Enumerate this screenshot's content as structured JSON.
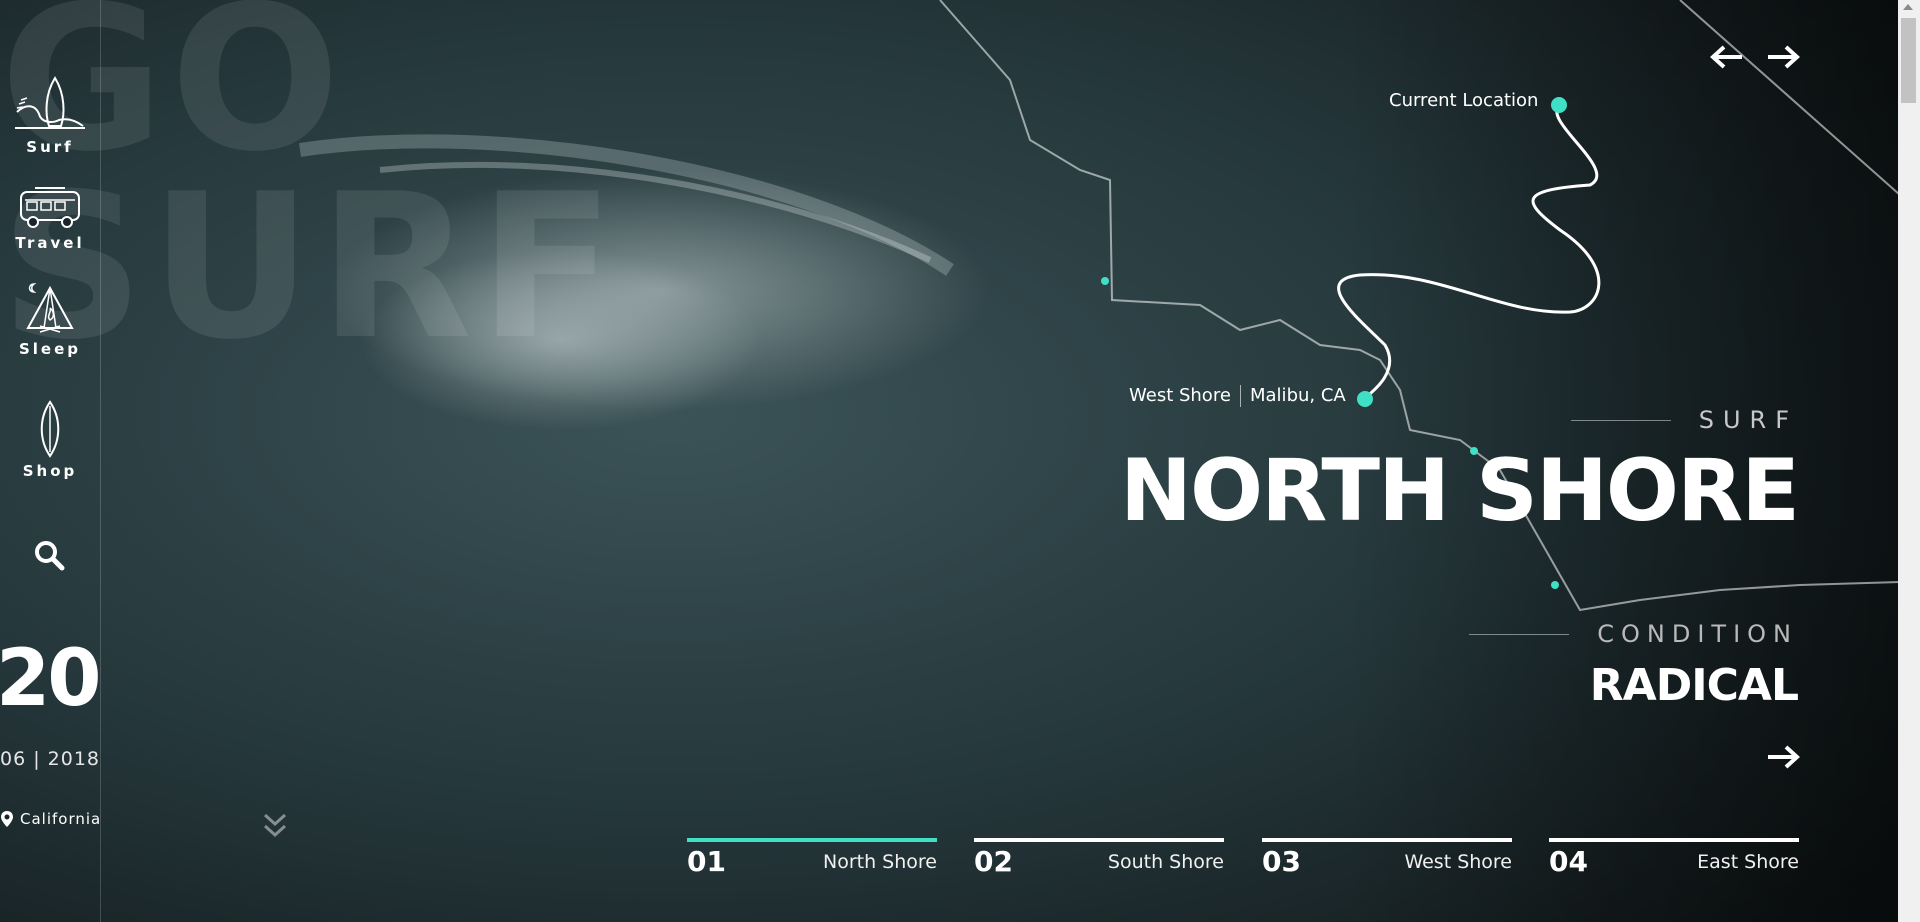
{
  "ghost_text": {
    "line1": "GO",
    "line2": "SURF"
  },
  "sidebar": {
    "items": [
      {
        "label": "Surf",
        "icon": "surfboard-wave-icon"
      },
      {
        "label": "Travel",
        "icon": "van-icon"
      },
      {
        "label": "Sleep",
        "icon": "tent-icon"
      },
      {
        "label": "Shop",
        "icon": "surfboard-icon"
      }
    ],
    "search_icon": "search-icon"
  },
  "date": {
    "day": "20",
    "month_year": "06 | 2018"
  },
  "location": {
    "label": "California",
    "icon": "map-pin-icon"
  },
  "map": {
    "current_location": "Current Location",
    "spot": "West Shore",
    "city": "Malibu, CA"
  },
  "hero": {
    "kicker": "SURF",
    "title": "NORTH SHORE",
    "condition_kicker": "CONDITION",
    "condition_value": "RADICAL"
  },
  "tabs": [
    {
      "num": "01",
      "name": "North Shore",
      "active": true
    },
    {
      "num": "02",
      "name": "South Shore",
      "active": false
    },
    {
      "num": "03",
      "name": "West Shore",
      "active": false
    },
    {
      "num": "04",
      "name": "East Shore",
      "active": false
    }
  ],
  "colors": {
    "accent": "#3fe0c5",
    "background": "#1b2428",
    "text": "#ffffff"
  }
}
